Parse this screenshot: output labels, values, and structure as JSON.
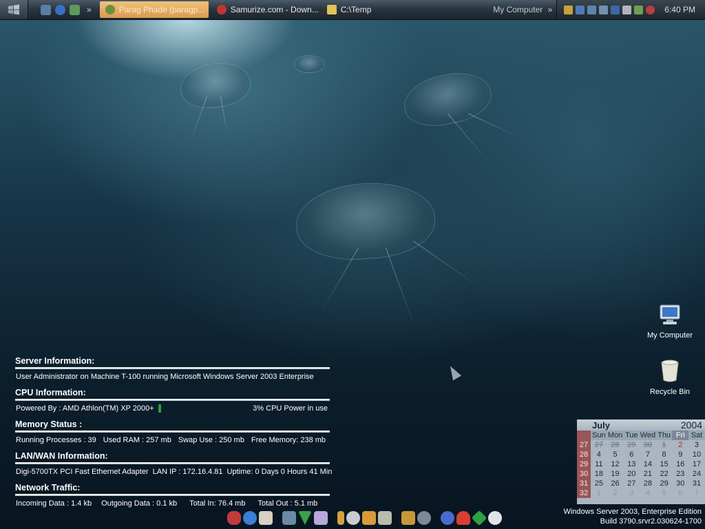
{
  "taskbar": {
    "tasks": [
      {
        "label": "Parag Phade (paragp..."
      },
      {
        "label": "Samurize.com - Down..."
      },
      {
        "label": "C:\\Temp"
      }
    ],
    "toolbar_label": "My Computer",
    "clock": "6:40 PM"
  },
  "info": {
    "server_heading": "Server Information:",
    "server_text": "User Administrator on Machine T-100 running Microsoft Windows Server 2003 Enterprise",
    "cpu_heading": "CPU Information:",
    "cpu_text": "Powered By : AMD Athlon(TM) XP 2000+",
    "cpu_usage": "3% CPU Power in use",
    "memory_heading": "Memory Status :",
    "memory_processes": "Running Processes : 39",
    "memory_used": "Used RAM : 257 mb",
    "memory_swap": "Swap Use : 250 mb",
    "memory_free": "Free Memory: 238 mb",
    "lan_heading": "LAN/WAN  Information:",
    "lan_adapter": "Digi-5700TX PCI Fast Ethernet Adapter",
    "lan_ip": "LAN IP :  172.16.4.81",
    "lan_uptime": "Uptime: 0 Days 0 Hours 41 Min",
    "net_heading": "Network Traffic:",
    "net_in": "Incoming Data : 1.4 kb",
    "net_out": "Outgoing Data : 0.1 kb",
    "net_total_in": "Total In: 76.4 mb",
    "net_total_out": "Total Out : 5.1 mb"
  },
  "desktop_icons": {
    "my_computer": "My Computer",
    "recycle_bin": "Recycle Bin"
  },
  "calendar": {
    "month": "July",
    "year": "2004",
    "days": [
      "Sun",
      "Mon",
      "Tue",
      "Wed",
      "Thu",
      "Fri",
      "Sat"
    ],
    "weeks": [
      {
        "wk": "27",
        "d": [
          "27",
          "28",
          "29",
          "30",
          "1",
          "2",
          "3"
        ]
      },
      {
        "wk": "28",
        "d": [
          "4",
          "5",
          "6",
          "7",
          "8",
          "9",
          "10"
        ]
      },
      {
        "wk": "29",
        "d": [
          "11",
          "12",
          "13",
          "14",
          "15",
          "16",
          "17"
        ]
      },
      {
        "wk": "30",
        "d": [
          "18",
          "19",
          "20",
          "21",
          "22",
          "23",
          "24"
        ]
      },
      {
        "wk": "31",
        "d": [
          "25",
          "26",
          "27",
          "28",
          "29",
          "30",
          "31"
        ]
      },
      {
        "wk": "32",
        "d": [
          "1",
          "2",
          "3",
          "4",
          "5",
          "6",
          "7"
        ]
      }
    ]
  },
  "build": {
    "line1": "Windows Server 2003, Enterprise Edition",
    "line2": "Build 3790.srvr2.030624-1700"
  },
  "colors": {
    "active_task": "#e0a45a",
    "cpu_bar": "#2aa03a",
    "week_column": "#9a5555"
  }
}
